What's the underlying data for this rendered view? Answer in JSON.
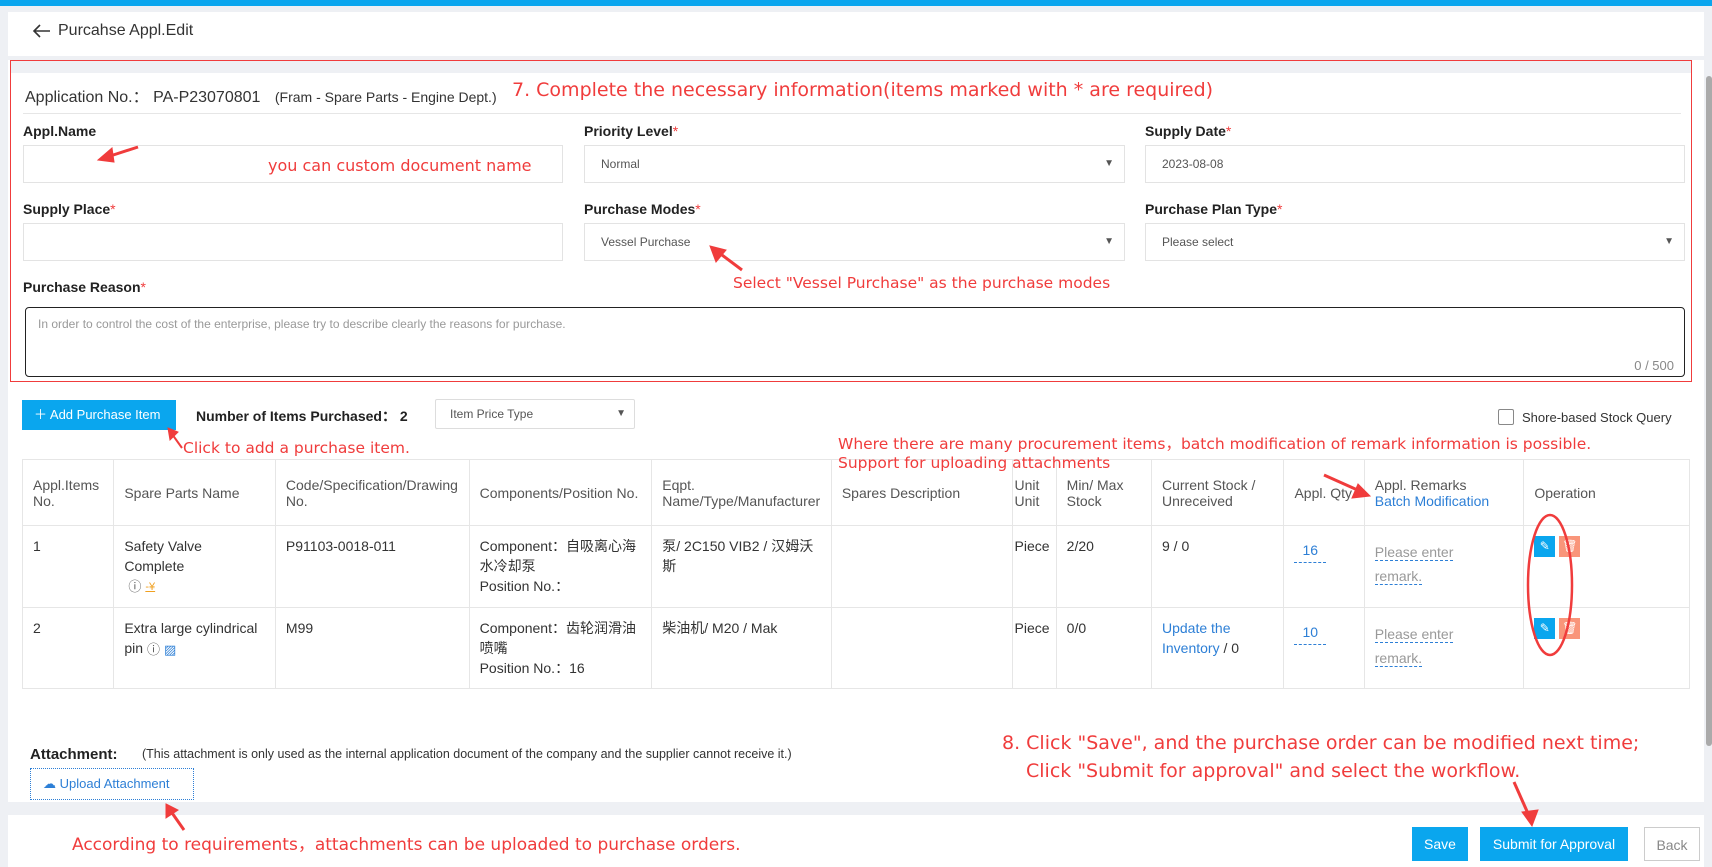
{
  "header": {
    "back_label": "Purcahse Appl.Edit"
  },
  "application": {
    "label": "Application No.：",
    "number": "PA-P23070801",
    "dept": "(Fram - Spare Parts - Engine Dept.)"
  },
  "form": {
    "appl_name": {
      "label": "Appl.Name",
      "value": ""
    },
    "priority_level": {
      "label": "Priority Level",
      "required": "*",
      "value": "Normal"
    },
    "supply_date": {
      "label": "Supply Date",
      "required": "*",
      "value": "2023-08-08"
    },
    "supply_place": {
      "label": "Supply Place",
      "required": "*",
      "value": ""
    },
    "purchase_modes": {
      "label": "Purchase Modes",
      "required": "*",
      "value": "Vessel Purchase"
    },
    "purchase_plan_type": {
      "label": "Purchase Plan Type",
      "required": "*",
      "value": "Please select"
    },
    "purchase_reason": {
      "label": "Purchase Reason",
      "required": "*",
      "placeholder": "In order to control the cost of the enterprise, please try to describe clearly the reasons for purchase.",
      "counter": "0 / 500"
    }
  },
  "items_toolbar": {
    "add_label": "Add Purchase Item",
    "count_label": "Number of Items Purchased：",
    "count": "2",
    "price_type": "Item Price Type",
    "shore_query_label": "Shore-based Stock Query"
  },
  "table": {
    "headers": {
      "no": "Appl.Items No.",
      "name": "Spare Parts Name",
      "code": "Code/Specification/Drawing No.",
      "component": "Components/Position No.",
      "eqpt": "Eqpt. Name/Type/Manufacturer",
      "desc": "Spares Description",
      "unit": "Unit Unit",
      "minmax": "Min/ Max Stock",
      "stock": "Current Stock / Unreceived",
      "qty": "Appl. Qty",
      "remarks": "Appl. Remarks",
      "batch": "Batch Modification",
      "operation": "Operation"
    },
    "rows": [
      {
        "no": "1",
        "name": "Safety Valve Complete",
        "code": "P91103-0018-011",
        "component": "Component：自吸离心海水冷却泵",
        "position": "Position No.：",
        "eqpt": "泵/ 2C150 VIB2 / 汉姆沃斯",
        "desc": "",
        "unit": "Piece",
        "minmax": "2/20",
        "stock": "9 / 0",
        "stock_link": "",
        "qty": "16",
        "remark_placeholder_1": "Please enter",
        "remark_placeholder_2": "remark."
      },
      {
        "no": "2",
        "name": "Extra large cylindrical pin",
        "code": "M99",
        "component": "Component：齿轮润滑油喷嘴",
        "position": "Position No.：16",
        "eqpt": "柴油机/ M20 / Mak",
        "desc": "",
        "unit": "Piece",
        "minmax": "0/0",
        "stock": " / 0",
        "stock_link": "Update the Inventory",
        "qty": "10",
        "remark_placeholder_1": "Please enter",
        "remark_placeholder_2": "remark."
      }
    ]
  },
  "attachment": {
    "label": "Attachment:",
    "note": "(This attachment is only used as the internal application document of the company and the supplier cannot receive it.)",
    "upload_label": "Upload Attachment"
  },
  "footer": {
    "save": "Save",
    "submit": "Submit for Approval",
    "back": "Back"
  },
  "annotations": {
    "step7": "7. Complete the necessary information(items marked with * are required)",
    "custom_name": "you can custom document name",
    "vessel_purchase": "Select \"Vessel Purchase\" as the purchase modes",
    "add_item": "Click to add a purchase item.",
    "batch_1": "Where there are many procurement items，batch modification of remark information is possible.",
    "batch_2": "Support for uploading attachments",
    "step8_1": "8. Click \"Save\", and the purchase order can be modified next time;",
    "step8_2": "Click \"Submit for approval\" and select the workflow.",
    "attachments": "According to requirements，attachments can be uploaded to purchase orders."
  },
  "colors": {
    "accent": "#0aa6ee",
    "annotation": "#f03c3c",
    "link": "#2d7fd6",
    "delete": "#f9957a"
  }
}
